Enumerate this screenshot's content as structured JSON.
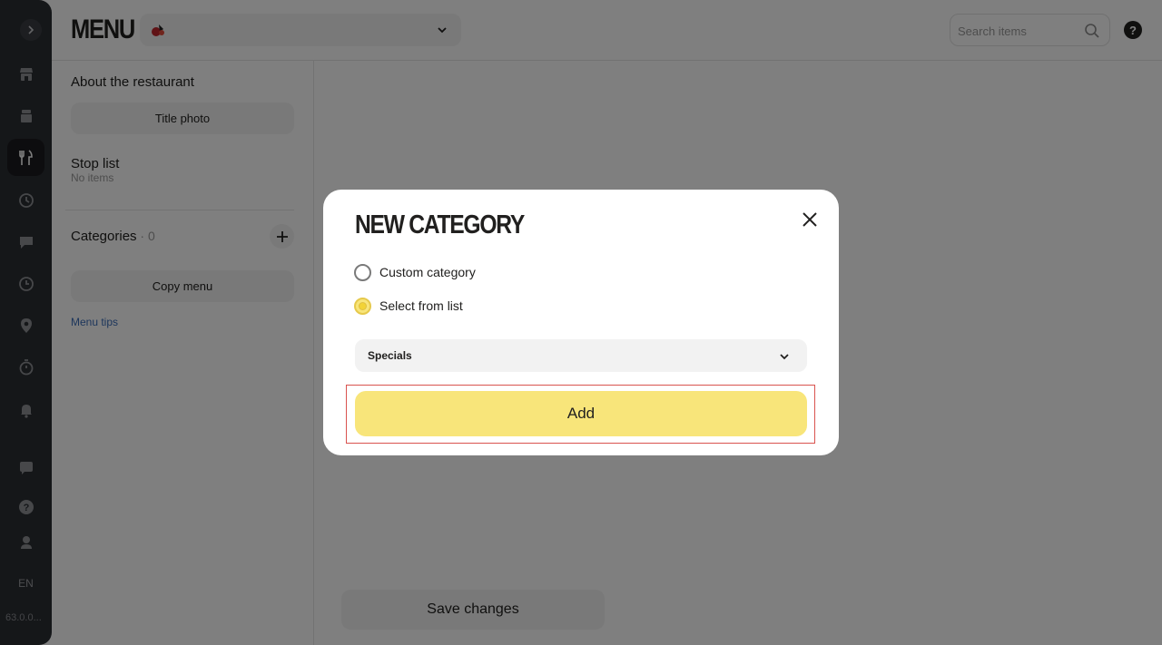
{
  "rail": {
    "items": [
      {
        "icon": "store-icon"
      },
      {
        "icon": "orders-icon"
      },
      {
        "icon": "menu-fork-knife-icon"
      },
      {
        "icon": "history-icon"
      },
      {
        "icon": "feedback-icon"
      },
      {
        "icon": "clock-icon"
      },
      {
        "icon": "location-pin-icon"
      },
      {
        "icon": "timer-icon"
      },
      {
        "icon": "bell-icon"
      },
      {
        "icon": "chat-icon"
      },
      {
        "icon": "help-circle-icon"
      },
      {
        "icon": "user-icon"
      }
    ],
    "language": "EN",
    "version": "63.0.0..."
  },
  "header": {
    "title": "MENU",
    "search_placeholder": "Search items",
    "help_label": "?"
  },
  "panel": {
    "about_title": "About the restaurant",
    "title_photo_label": "Title photo",
    "stop_list_title": "Stop list",
    "stop_list_sub": "No items",
    "categories_title": "Categories",
    "categories_sep": " · ",
    "categories_count": "0",
    "copy_menu_label": "Copy menu",
    "menu_tips_label": "Menu tips"
  },
  "footer": {
    "save_label": "Save changes"
  },
  "modal": {
    "title": "NEW CATEGORY",
    "options": [
      {
        "label": "Custom category",
        "checked": false
      },
      {
        "label": "Select from list",
        "checked": true
      }
    ],
    "select_value": "Specials",
    "add_label": "Add"
  },
  "colors": {
    "accent_yellow": "#f8e57a",
    "rail_bg": "#2b2e33",
    "link_blue": "#3b6db8",
    "highlight_red": "#d9534f"
  }
}
